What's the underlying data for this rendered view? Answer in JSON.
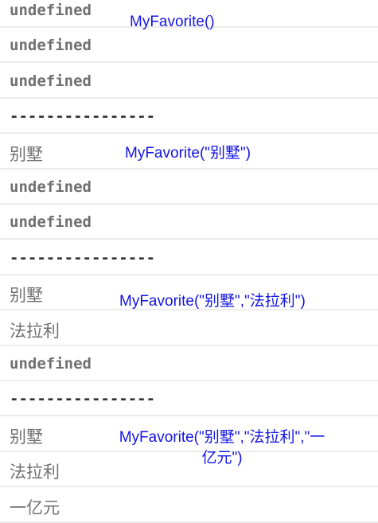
{
  "console_lines": [
    {
      "text": "undefined",
      "kind": "mono"
    },
    {
      "text": "undefined",
      "kind": "mono"
    },
    {
      "text": "undefined",
      "kind": "mono"
    },
    {
      "text": "----------------",
      "kind": "dash"
    },
    {
      "text": "别墅",
      "kind": "cjk"
    },
    {
      "text": "undefined",
      "kind": "mono"
    },
    {
      "text": "undefined",
      "kind": "mono"
    },
    {
      "text": "----------------",
      "kind": "dash"
    },
    {
      "text": "别墅",
      "kind": "cjk"
    },
    {
      "text": "法拉利",
      "kind": "cjk"
    },
    {
      "text": "undefined",
      "kind": "mono"
    },
    {
      "text": "----------------",
      "kind": "dash"
    },
    {
      "text": "别墅",
      "kind": "cjk"
    },
    {
      "text": "法拉利",
      "kind": "cjk"
    },
    {
      "text": "一亿元",
      "kind": "cjk"
    }
  ],
  "annotations": [
    "MyFavorite()",
    "MyFavorite(\"别墅\")",
    "MyFavorite(\"别墅\",\"法拉利\")",
    "MyFavorite(\"别墅\",\"法拉利\",\"一亿元\")"
  ],
  "annotation_color": "#1414e6"
}
